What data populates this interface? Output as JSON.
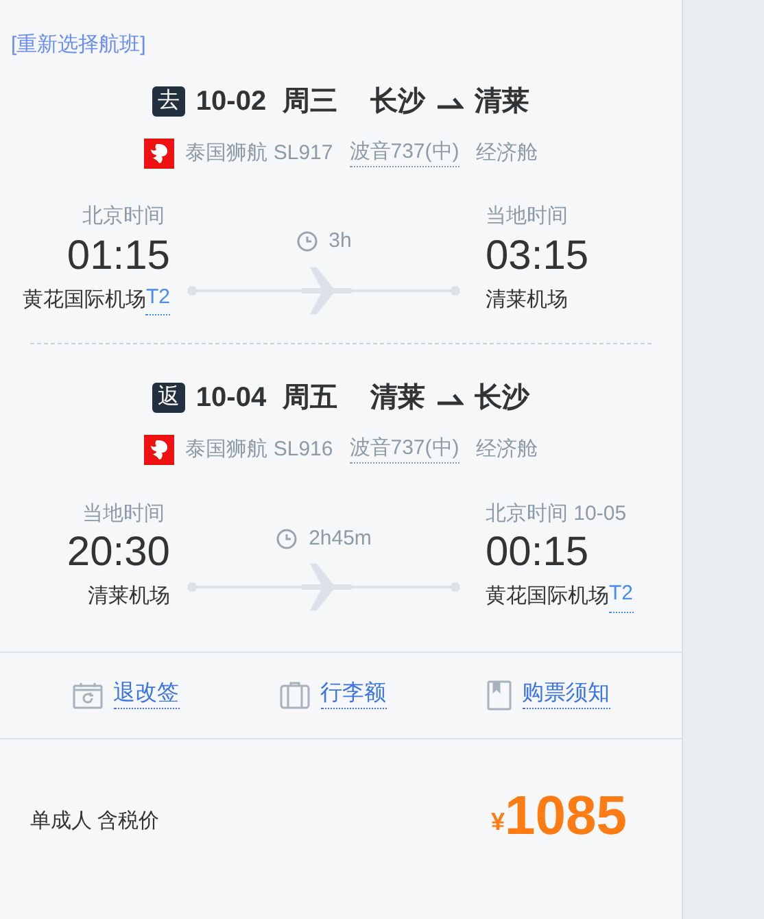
{
  "reselect_link": "[重新选择航班]",
  "flights": [
    {
      "badge": "去",
      "date": "10-02",
      "weekday": "周三",
      "from": "长沙",
      "to": "清莱",
      "airline": "泰国狮航 SL917",
      "aircraft": "波音737(中)",
      "cabin": "经济舱",
      "duration": "3h",
      "depart": {
        "zone": "北京时间",
        "time": "01:15",
        "airport": "黄花国际机场",
        "terminal": "T2"
      },
      "arrive": {
        "zone": "当地时间",
        "time": "03:15",
        "airport": "清莱机场"
      }
    },
    {
      "badge": "返",
      "date": "10-04",
      "weekday": "周五",
      "from": "清莱",
      "to": "长沙",
      "airline": "泰国狮航 SL916",
      "aircraft": "波音737(中)",
      "cabin": "经济舱",
      "duration": "2h45m",
      "depart": {
        "zone": "当地时间",
        "time": "20:30",
        "airport": "清莱机场"
      },
      "arrive": {
        "zone": "北京时间 10-05",
        "time": "00:15",
        "airport": "黄花国际机场",
        "terminal": "T2"
      }
    }
  ],
  "links": [
    {
      "kind": "refund",
      "label": "退改签"
    },
    {
      "kind": "baggage",
      "label": "行李额"
    },
    {
      "kind": "notice",
      "label": "购票须知"
    }
  ],
  "price": {
    "label": "单成人 含税价",
    "currency": "¥",
    "amount": "1085"
  }
}
